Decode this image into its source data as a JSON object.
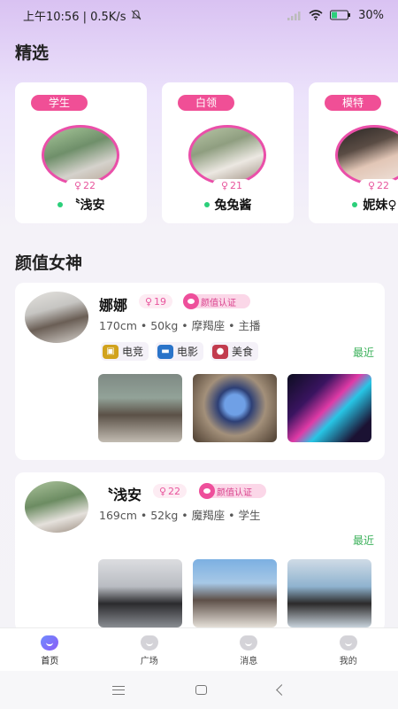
{
  "status_bar": {
    "time_speed": "上午10:56 | 0.5K/s",
    "battery": "30%"
  },
  "featured": {
    "title": "精选",
    "cards": [
      {
        "badge": "学生",
        "age": "22",
        "name": "〝浅安"
      },
      {
        "badge": "白领",
        "age": "21",
        "name": "兔兔酱"
      },
      {
        "badge": "模特",
        "age": "22",
        "name": "妮妹♀"
      }
    ]
  },
  "goddess": {
    "title": "颜值女神",
    "users": [
      {
        "name": "娜娜",
        "age": "19",
        "verify": "颜值认证",
        "info": "170cm • 50kg • 摩羯座 • 主播",
        "tags": [
          {
            "icon": "gamepad-icon",
            "label": "电竞"
          },
          {
            "icon": "film-icon",
            "label": "电影"
          },
          {
            "icon": "food-icon",
            "label": "美食"
          }
        ],
        "recent": "最近"
      },
      {
        "name": "〝浅安",
        "age": "22",
        "verify": "颜值认证",
        "info": "169cm • 52kg • 魔羯座 • 学生",
        "tags": [],
        "recent": "最近"
      }
    ]
  },
  "tabbar": {
    "items": [
      {
        "label": "首页",
        "active": true
      },
      {
        "label": "广场",
        "active": false
      },
      {
        "label": "消息",
        "active": false
      },
      {
        "label": "我的",
        "active": false
      }
    ]
  },
  "colors": {
    "accent_pink": "#f04f96",
    "online_green": "#2bcf7a",
    "recent_green": "#3cb15b"
  }
}
